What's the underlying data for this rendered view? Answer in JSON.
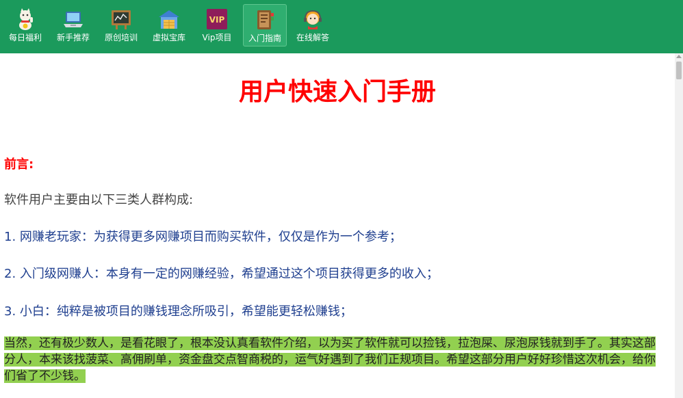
{
  "toolbar": {
    "items": [
      {
        "label": "每日福利",
        "icon": "lucky-cat-icon"
      },
      {
        "label": "新手推荐",
        "icon": "laptop-icon"
      },
      {
        "label": "原创培训",
        "icon": "blackboard-icon"
      },
      {
        "label": "虚拟宝库",
        "icon": "warehouse-icon"
      },
      {
        "label": "Vip项目",
        "icon": "vip-icon",
        "badge_text": "VIP"
      },
      {
        "label": "入门指南",
        "icon": "guide-book-icon",
        "active": true
      },
      {
        "label": "在线解答",
        "icon": "customer-service-icon"
      }
    ],
    "background": "#1b9a5c"
  },
  "article": {
    "title": "用户快速入门手册",
    "preface_heading": "前言:",
    "intro": "软件用户主要由以下三类人群构成:",
    "groups": [
      "1. 网赚老玩家：为获得更多网赚项目而购买软件，仅仅是作为一个参考；",
      "2. 入门级网赚人：本身有一定的网赚经验，希望通过这个项目获得更多的收入；",
      "3. 小白：纯粹是被项目的赚钱理念所吸引，希望能更轻松赚钱；"
    ],
    "highlight": "当然，还有极少数人，是看花眼了，根本没认真看软件介绍，以为买了软件就可以捡钱，拉泡屎、尿泡尿钱就到手了。其实这部分人，本来该找菠菜、高佣刷单，资金盘交点智商税的，运气好遇到了我们正规项目。希望这部分用户好好珍惜这次机会，给你们省了不少钱。",
    "title_color": "#ff0000",
    "list_color": "#1f3f8f",
    "highlight_color": "#92d050"
  }
}
